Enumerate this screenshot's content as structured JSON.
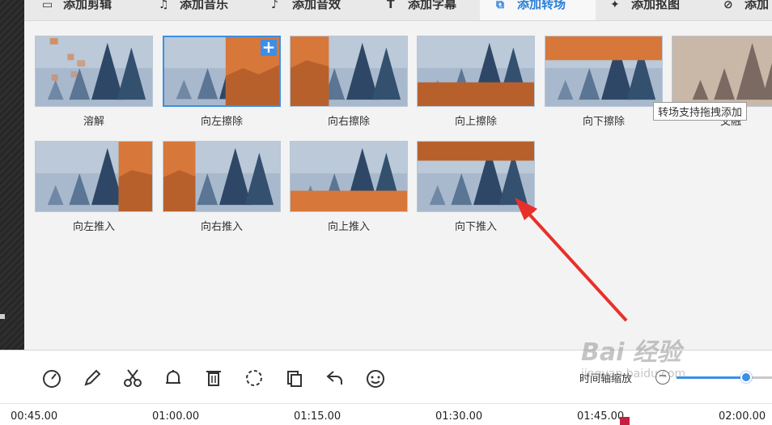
{
  "tabs": [
    {
      "label": "添加剪辑",
      "icon": "clip-icon"
    },
    {
      "label": "添加音乐",
      "icon": "music-icon"
    },
    {
      "label": "添加音效",
      "icon": "sound-effect-icon"
    },
    {
      "label": "添加字幕",
      "icon": "subtitle-icon"
    },
    {
      "label": "添加转场",
      "icon": "transition-icon",
      "active": true
    },
    {
      "label": "添加抠图",
      "icon": "cutout-icon"
    },
    {
      "label": "添加",
      "icon": "more-icon"
    }
  ],
  "transitions": [
    {
      "label": "溶解",
      "icon": "dissolve-transition"
    },
    {
      "label": "向左擦除",
      "icon": "wipe-left-transition",
      "selected": true
    },
    {
      "label": "向右擦除",
      "icon": "wipe-right-transition"
    },
    {
      "label": "向上擦除",
      "icon": "wipe-up-transition"
    },
    {
      "label": "向下擦除",
      "icon": "wipe-down-transition"
    },
    {
      "label": "交融",
      "icon": "blend-transition"
    },
    {
      "label": "向左推入",
      "icon": "push-left-transition"
    },
    {
      "label": "向右推入",
      "icon": "push-right-transition"
    },
    {
      "label": "向上推入",
      "icon": "push-up-transition"
    },
    {
      "label": "向下推入",
      "icon": "push-down-transition"
    }
  ],
  "add_button_label": "+",
  "tooltip": "转场支持拖拽添加",
  "toolbar": {
    "tools": [
      "speed-icon",
      "edit-icon",
      "cut-icon",
      "bell-icon",
      "delete-icon",
      "unlink-icon",
      "copy-icon",
      "undo-icon",
      "emoji-icon"
    ],
    "zoom_label": "时间轴缩放",
    "zoom_minus": "−",
    "zoom_level": 0.73
  },
  "timeline": {
    "ticks": [
      "00:45.00",
      "01:00.00",
      "01:15.00",
      "01:30.00",
      "01:45.00",
      "02:00.00"
    ]
  },
  "watermark": {
    "title": "Bai 经验",
    "url": "jingyan.baidu.com"
  },
  "colors": {
    "accent": "#3b8fe6",
    "orange": "#d8773a",
    "annotation_arrow": "#e8302a"
  }
}
